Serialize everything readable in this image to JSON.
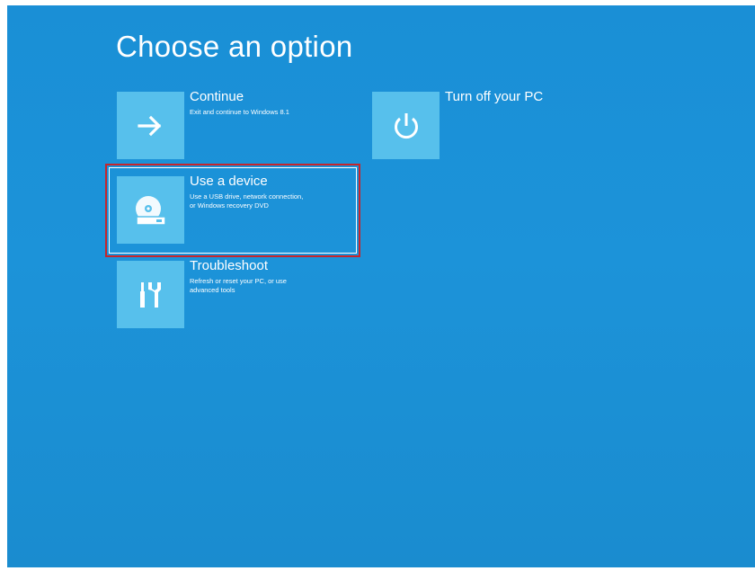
{
  "screen": {
    "title": "Choose an option"
  },
  "options": {
    "continue": {
      "title": "Continue",
      "desc": [
        "Exit and continue to Windows 8.1"
      ],
      "icon": "arrow-right-icon"
    },
    "turn_off": {
      "title": "Turn off your PC",
      "icon": "power-icon"
    },
    "use_device": {
      "title": "Use a device",
      "desc": [
        "Use a USB drive, network connection,",
        "or Windows recovery DVD"
      ],
      "icon": "disc-drive-icon",
      "highlighted": true
    },
    "troubleshoot": {
      "title": "Troubleshoot",
      "desc": [
        "Refresh or reset your PC, or use",
        "advanced tools"
      ],
      "icon": "tools-icon"
    }
  },
  "colors": {
    "background": "#1a8fd6",
    "tile": "#57c0ec",
    "text": "#ffffff",
    "highlight_border": "#c7252b"
  }
}
